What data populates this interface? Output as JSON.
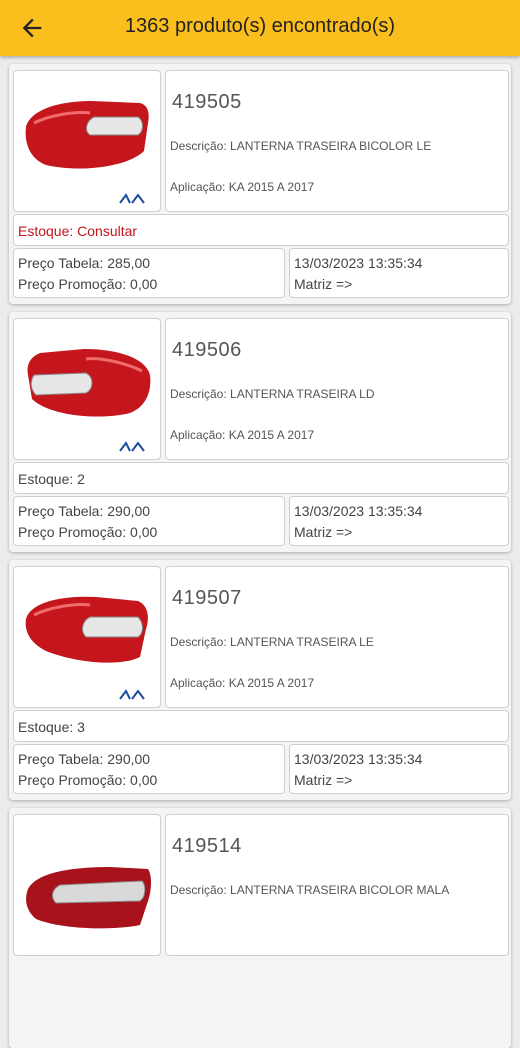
{
  "header": {
    "title": "1363 produto(s) encontrado(s)",
    "back_icon": "arrow-left-icon",
    "color": "#fbbf1d"
  },
  "products": [
    {
      "code": "419505",
      "description": "Descrição: LANTERNA TRASEIRA BICOLOR LE",
      "application": "Aplicação: KA 2015 A 2017",
      "stock": "Estoque: Consultar",
      "price_table": "Preço Tabela: 285,00",
      "price_promo": "Preço Promoção: 0,00",
      "date": "13/03/2023 13:35:34",
      "branch": "Matriz =>"
    },
    {
      "code": "419506",
      "description": "Descrição: LANTERNA TRASEIRA LD",
      "application": "Aplicação: KA 2015 A 2017",
      "stock": "Estoque: 2",
      "price_table": "Preço Tabela: 290,00",
      "price_promo": "Preço Promoção: 0,00",
      "date": "13/03/2023 13:35:34",
      "branch": "Matriz =>"
    },
    {
      "code": "419507",
      "description": "Descrição: LANTERNA TRASEIRA LE",
      "application": "Aplicação: KA 2015 A 2017",
      "stock": "Estoque: 3",
      "price_table": "Preço Tabela: 290,00",
      "price_promo": "Preço Promoção: 0,00",
      "date": "13/03/2023 13:35:34",
      "branch": "Matriz =>"
    },
    {
      "code": "419514",
      "description": "Descrição: LANTERNA TRASEIRA BICOLOR MALA",
      "application": "",
      "stock": "",
      "price_table": "",
      "price_promo": "",
      "date": "",
      "branch": ""
    }
  ],
  "colors": {
    "stock_alert": "#c0161e",
    "lamp_red": "#c4161c"
  }
}
